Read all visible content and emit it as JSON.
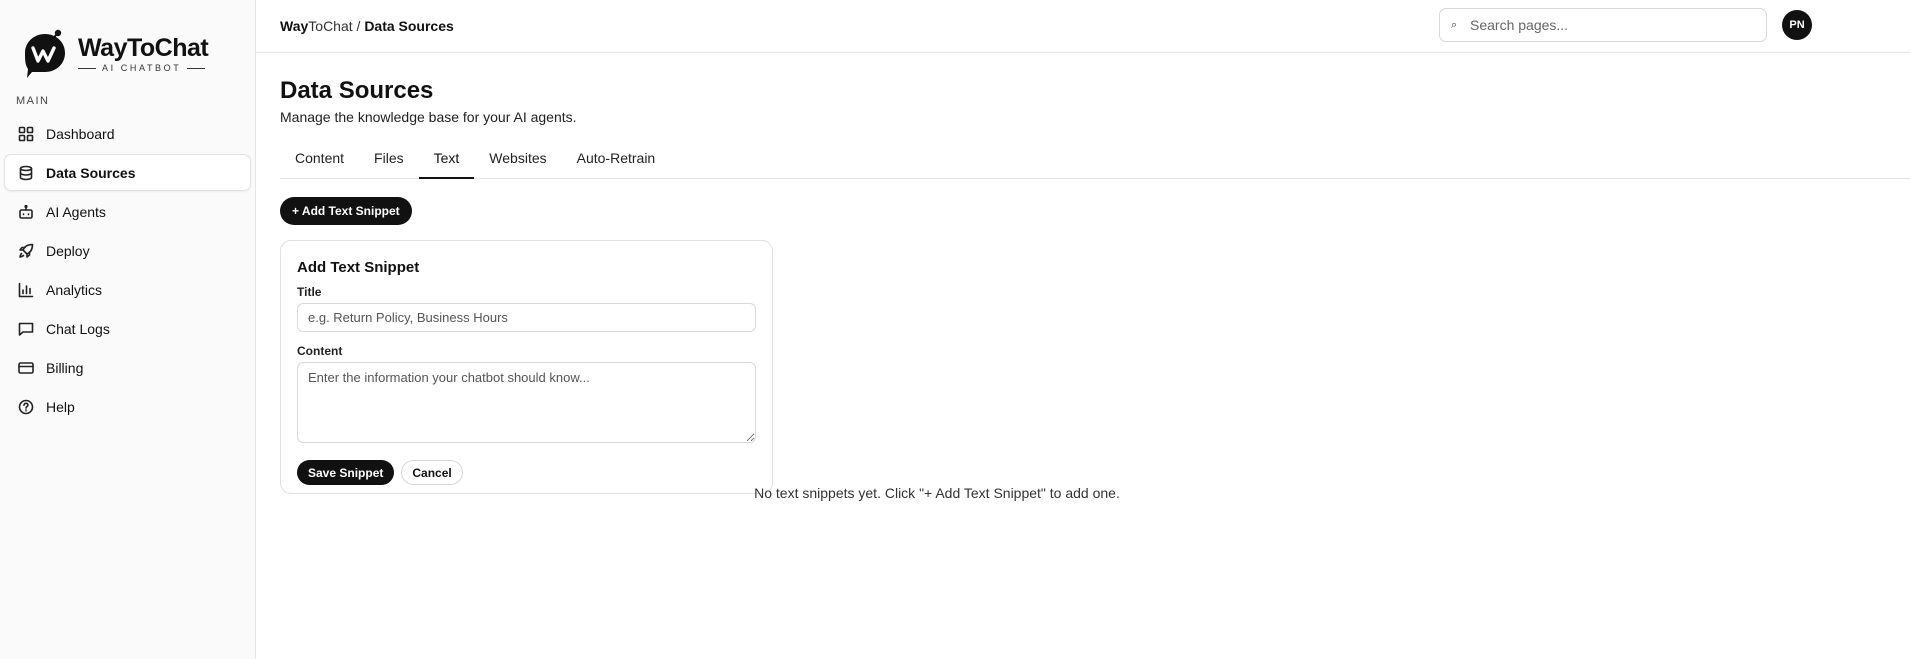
{
  "brand": {
    "name": "WayToChat",
    "tagline": "AI CHATBOT"
  },
  "sidebar": {
    "section_label": "MAIN",
    "items": [
      {
        "label": "Dashboard",
        "icon": "grid-icon"
      },
      {
        "label": "Data Sources",
        "icon": "database-icon",
        "active": true
      },
      {
        "label": "AI Agents",
        "icon": "bot-icon"
      },
      {
        "label": "Deploy",
        "icon": "rocket-icon"
      },
      {
        "label": "Analytics",
        "icon": "bar-chart-icon"
      },
      {
        "label": "Chat Logs",
        "icon": "message-square-icon"
      },
      {
        "label": "Billing",
        "icon": "credit-card-icon"
      },
      {
        "label": "Help",
        "icon": "help-circle-icon"
      }
    ]
  },
  "header": {
    "breadcrumb_root_bold": "Way",
    "breadcrumb_root_rest": "ToChat",
    "breadcrumb_sep": " / ",
    "breadcrumb_current": "Data Sources",
    "search_placeholder": "Search pages...",
    "avatar_initials": "PN"
  },
  "page": {
    "title": "Data Sources",
    "subtitle": "Manage the knowledge base for your AI agents.",
    "tabs": [
      {
        "label": "Content"
      },
      {
        "label": "Files"
      },
      {
        "label": "Text",
        "active": true
      },
      {
        "label": "Websites"
      },
      {
        "label": "Auto-Retrain"
      }
    ],
    "add_button": "+ Add Text Snippet",
    "form": {
      "title": "Add Text Snippet",
      "title_label": "Title",
      "title_placeholder": "e.g. Return Policy, Business Hours",
      "content_label": "Content",
      "content_placeholder": "Enter the information your chatbot should know...",
      "save_button": "Save Snippet",
      "cancel_button": "Cancel"
    },
    "empty_message": "No text snippets yet. Click \"+ Add Text Snippet\" to add one."
  }
}
